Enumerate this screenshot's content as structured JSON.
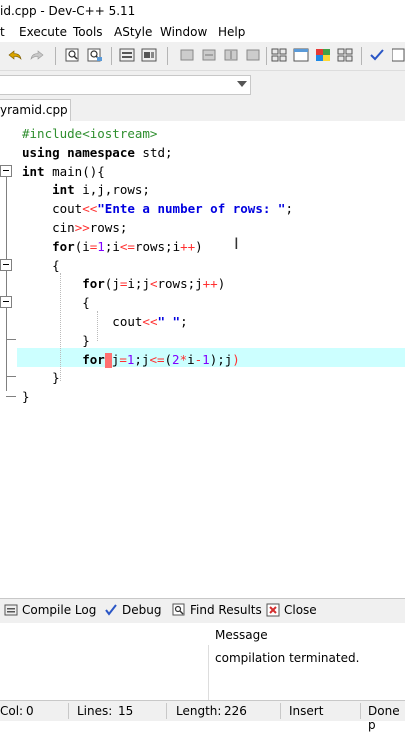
{
  "window": {
    "title": "id.cpp - Dev-C++ 5.11"
  },
  "menu": {
    "items": [
      "t",
      "Execute",
      "Tools",
      "AStyle",
      "Window",
      "Help"
    ]
  },
  "editor": {
    "tab_label": "yramid.cpp",
    "lines": [
      [
        {
          "t": "#include<iostream>",
          "c": "pp"
        }
      ],
      [
        {
          "t": "using namespace ",
          "c": "kw"
        },
        {
          "t": "std;"
        }
      ],
      [
        {
          "t": "int ",
          "c": "kw"
        },
        {
          "t": "main(){"
        }
      ],
      [
        {
          "t": "    "
        },
        {
          "t": "int ",
          "c": "kw"
        },
        {
          "t": "i,j,rows;"
        }
      ],
      [
        {
          "t": "    cout"
        },
        {
          "t": "<<",
          "c": "op"
        },
        {
          "t": "\"Ente a number of rows: \"",
          "c": "str"
        },
        {
          "t": ";"
        }
      ],
      [
        {
          "t": "    cin"
        },
        {
          "t": ">>",
          "c": "op"
        },
        {
          "t": "rows;"
        }
      ],
      [
        {
          "t": "    "
        },
        {
          "t": "for",
          "c": "kw"
        },
        {
          "t": "(i"
        },
        {
          "t": "=",
          "c": "op"
        },
        {
          "t": "1",
          "c": "num"
        },
        {
          "t": ";i"
        },
        {
          "t": "<=",
          "c": "op"
        },
        {
          "t": "rows;i"
        },
        {
          "t": "++",
          "c": "op"
        },
        {
          "t": ")"
        }
      ],
      [
        {
          "t": "    {"
        }
      ],
      [
        {
          "t": "        "
        },
        {
          "t": "for",
          "c": "kw"
        },
        {
          "t": "(j"
        },
        {
          "t": "=",
          "c": "op"
        },
        {
          "t": "i;j"
        },
        {
          "t": "<",
          "c": "op"
        },
        {
          "t": "rows;j"
        },
        {
          "t": "++",
          "c": "op"
        },
        {
          "t": ")"
        }
      ],
      [
        {
          "t": "        {"
        }
      ],
      [
        {
          "t": "            cout"
        },
        {
          "t": "<<",
          "c": "op"
        },
        {
          "t": "\" \"",
          "c": "str"
        },
        {
          "t": ";"
        }
      ],
      [
        {
          "t": "        }"
        }
      ],
      [
        {
          "t": "        "
        },
        {
          "t": "for",
          "c": "kw"
        },
        {
          "t": "CURSOR",
          "c": "cursor"
        },
        {
          "t": "j"
        },
        {
          "t": "=",
          "c": "op"
        },
        {
          "t": "1",
          "c": "num"
        },
        {
          "t": ";j"
        },
        {
          "t": "<=",
          "c": "op"
        },
        {
          "t": "("
        },
        {
          "t": "2",
          "c": "num"
        },
        {
          "t": "*",
          "c": "op"
        },
        {
          "t": "i"
        },
        {
          "t": "-",
          "c": "op"
        },
        {
          "t": "1",
          "c": "num"
        },
        {
          "t": ");j"
        },
        {
          "t": ")",
          "c": "op"
        }
      ],
      [
        {
          "t": "    }"
        }
      ],
      [
        {
          "t": "}"
        }
      ]
    ]
  },
  "bottom_panel": {
    "tabs": [
      {
        "label": "Compile Log",
        "icon": "compile-log-icon"
      },
      {
        "label": "Debug",
        "icon": "debug-check-icon"
      },
      {
        "label": "Find Results",
        "icon": "find-results-icon"
      },
      {
        "label": "Close",
        "icon": "close-icon"
      }
    ],
    "column_header": "Message",
    "message": "compilation terminated."
  },
  "statusbar": {
    "col_label": "Col:",
    "col_value": "0",
    "lines_label": "Lines:",
    "lines_value": "15",
    "length_label": "Length:",
    "length_value": "226",
    "mode": "Insert",
    "status": "Done p"
  }
}
